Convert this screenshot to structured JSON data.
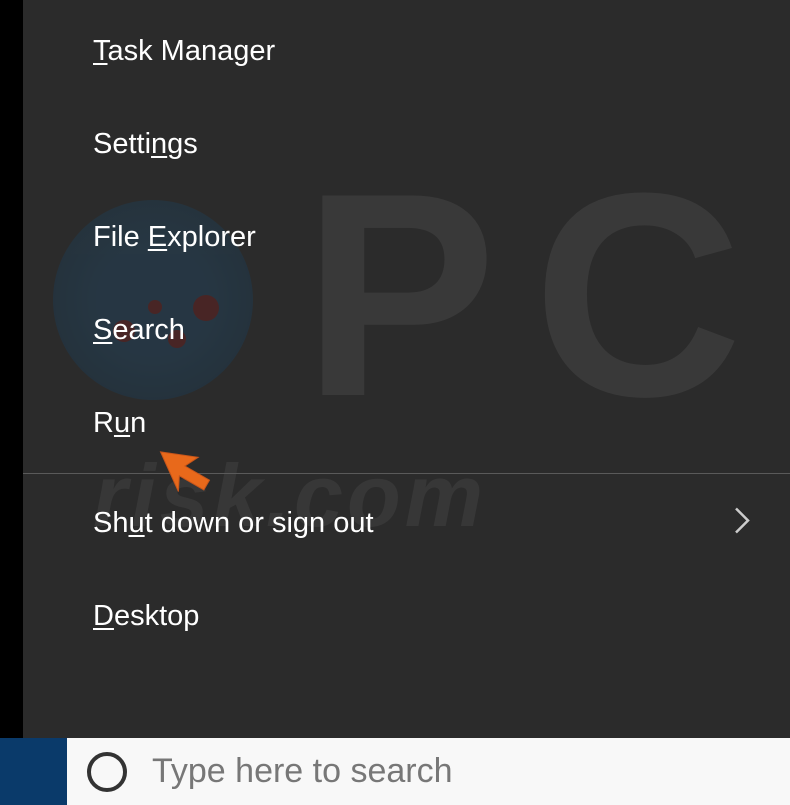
{
  "menu": {
    "items": [
      {
        "pre": "",
        "u": "T",
        "post": "ask Manager",
        "hasSubmenu": false,
        "name": "task-manager"
      },
      {
        "pre": "Setti",
        "u": "n",
        "post": "gs",
        "hasSubmenu": false,
        "name": "settings"
      },
      {
        "pre": "File ",
        "u": "E",
        "post": "xplorer",
        "hasSubmenu": false,
        "name": "file-explorer"
      },
      {
        "pre": "",
        "u": "S",
        "post": "earch",
        "hasSubmenu": false,
        "name": "search"
      },
      {
        "pre": "R",
        "u": "u",
        "post": "n",
        "hasSubmenu": false,
        "name": "run"
      }
    ],
    "afterDivider": [
      {
        "pre": "Sh",
        "u": "u",
        "post": "t down or sign out",
        "hasSubmenu": true,
        "name": "shut-down-sign-out"
      },
      {
        "pre": "",
        "u": "D",
        "post": "esktop",
        "hasSubmenu": false,
        "name": "desktop"
      }
    ]
  },
  "taskbar": {
    "searchPlaceholder": "Type here to search"
  },
  "watermark": {
    "text": "risk.com"
  }
}
